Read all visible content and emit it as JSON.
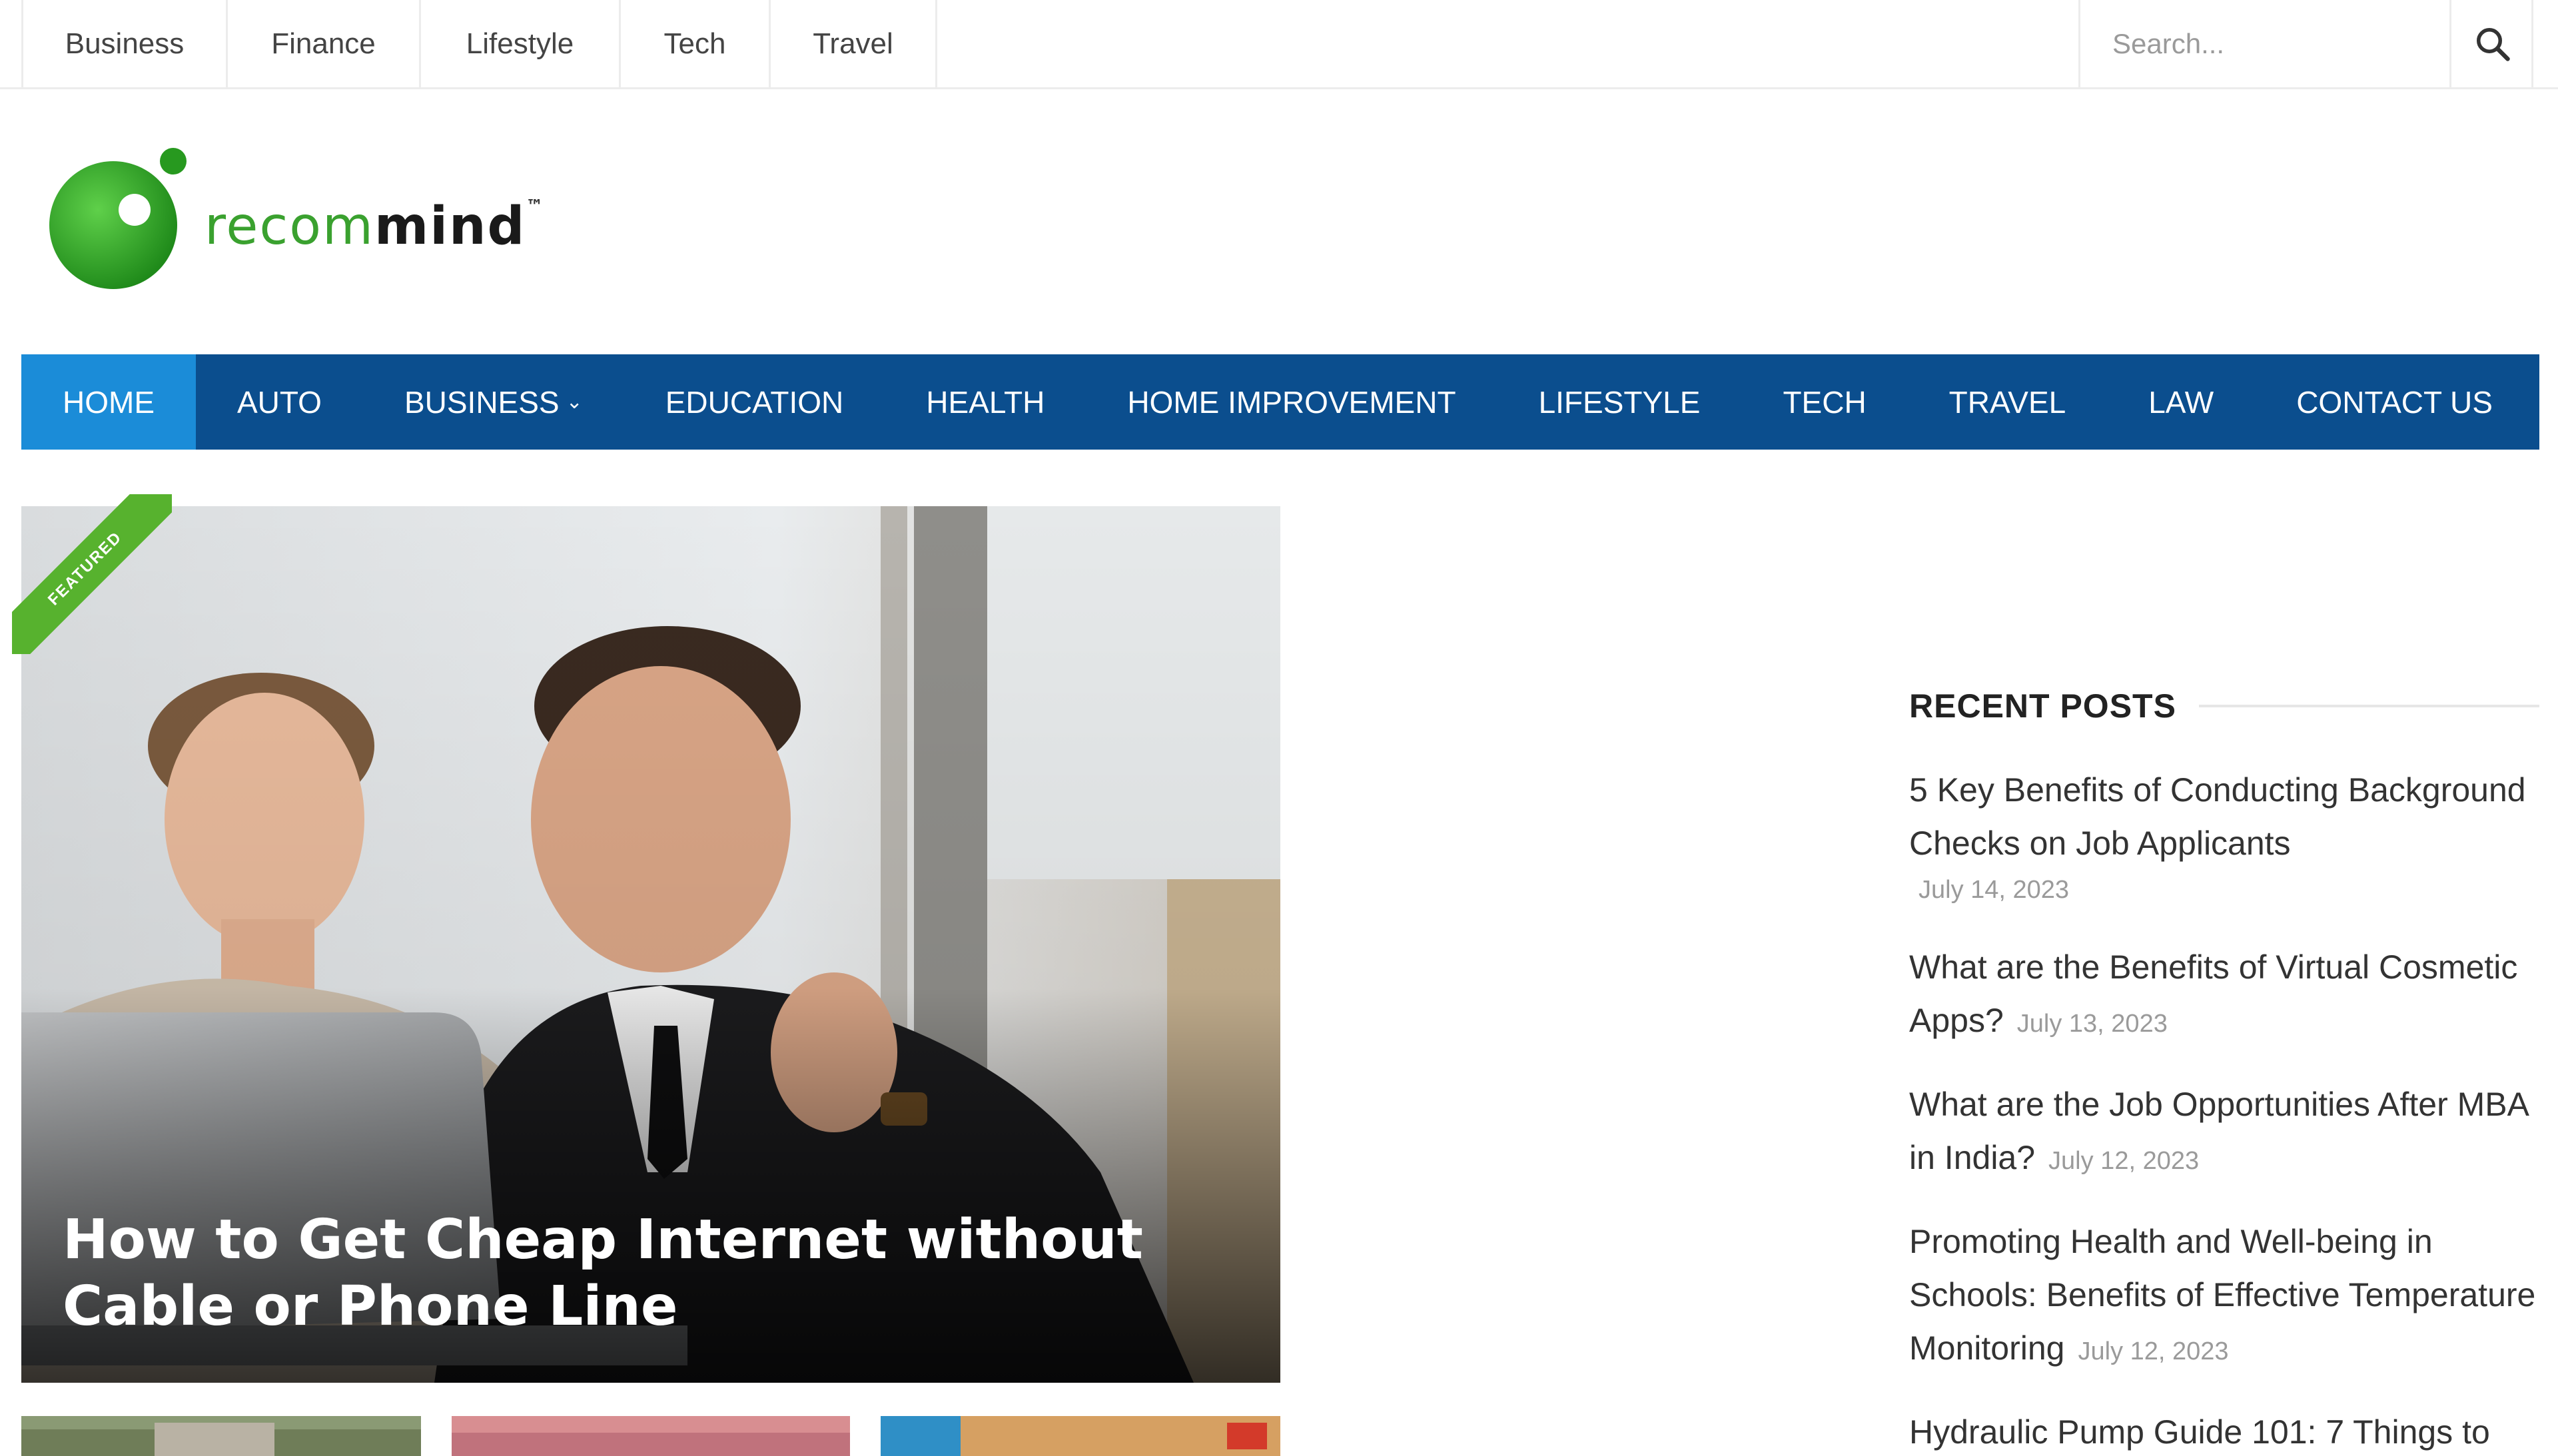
{
  "top_nav": {
    "links": [
      "Business",
      "Finance",
      "Lifestyle",
      "Tech",
      "Travel"
    ],
    "search_placeholder": "Search..."
  },
  "logo": {
    "text_part1": "recom",
    "text_part2": "mind",
    "tm": "™",
    "colors": {
      "green": "#3aa12f",
      "dark": "#1a1a1a"
    }
  },
  "main_nav": {
    "items": [
      "HOME",
      "AUTO",
      "BUSINESS",
      "EDUCATION",
      "HEALTH",
      "HOME IMPROVEMENT",
      "LIFESTYLE",
      "TECH",
      "TRAVEL",
      "LAW",
      "CONTACT US"
    ],
    "active": "HOME",
    "colors": {
      "bar": "#0b4e8e",
      "active": "#1b8cd8"
    }
  },
  "featured": {
    "badge": "FEATURED",
    "title": "How to Get Cheap Internet without Cable or Phone Line"
  },
  "sidebar": {
    "recent_title": "RECENT POSTS",
    "posts": [
      {
        "title": "5 Key Benefits of Conducting Background Checks on Job Applicants",
        "date": "July 14, 2023"
      },
      {
        "title": "What are the Benefits of Virtual Cosmetic Apps?",
        "date": "July 13, 2023"
      },
      {
        "title": "What are the Job Opportunities After MBA in India?",
        "date": "July 12, 2023"
      },
      {
        "title": "Promoting Health and Well-being in Schools: Benefits of Effective Temperature Monitoring",
        "date": "July 12, 2023"
      },
      {
        "title": "Hydraulic Pump Guide 101: 7 Things to",
        "date": ""
      }
    ]
  }
}
